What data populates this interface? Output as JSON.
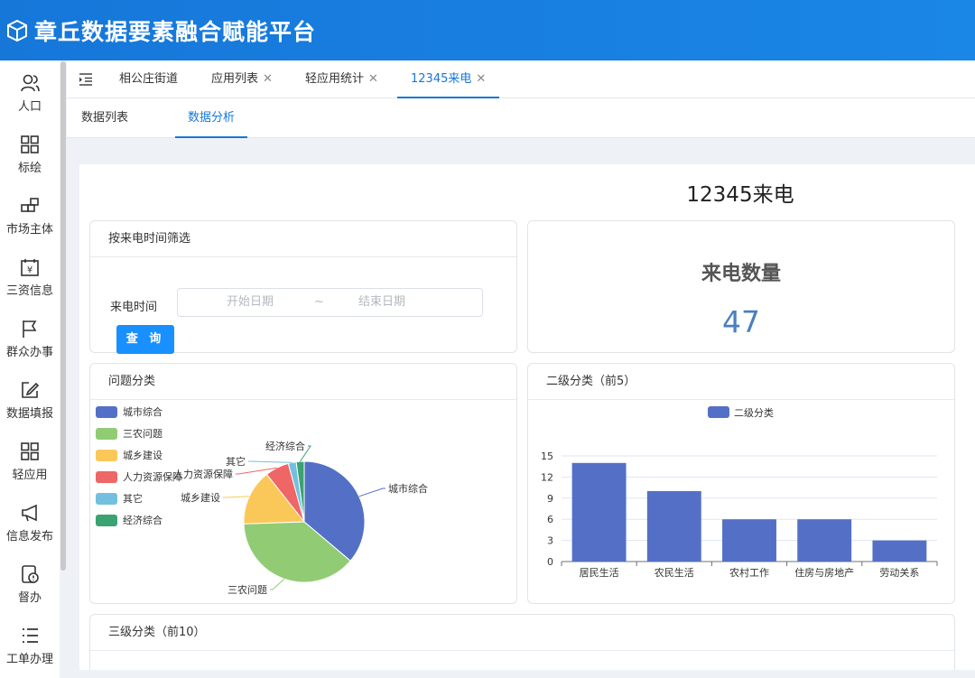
{
  "app": {
    "title": "章丘数据要素融合赋能平台"
  },
  "sidebar": {
    "items": [
      {
        "label": "人口",
        "icon": "people-icon"
      },
      {
        "label": "标绘",
        "icon": "grid-icon"
      },
      {
        "label": "市场主体",
        "icon": "blocks-icon"
      },
      {
        "label": "三资信息",
        "icon": "calendar-yen-icon"
      },
      {
        "label": "群众办事",
        "icon": "flag-icon"
      },
      {
        "label": "数据填报",
        "icon": "edit-icon"
      },
      {
        "label": "轻应用",
        "icon": "apps-icon"
      },
      {
        "label": "信息发布",
        "icon": "megaphone-icon"
      },
      {
        "label": "督办",
        "icon": "supervise-icon"
      },
      {
        "label": "工单办理",
        "icon": "list-icon"
      }
    ]
  },
  "tabs": [
    {
      "label": "相公庄街道",
      "closable": false
    },
    {
      "label": "应用列表",
      "closable": true
    },
    {
      "label": "轻应用统计",
      "closable": true
    },
    {
      "label": "12345来电",
      "closable": true,
      "active": true
    }
  ],
  "subtabs": [
    {
      "label": "数据列表"
    },
    {
      "label": "数据分析",
      "active": true
    }
  ],
  "page": {
    "heading": "12345来电"
  },
  "filter": {
    "title": "按来电时间筛选",
    "field_label": "来电时间",
    "start_placeholder": "开始日期",
    "separator": "~",
    "end_placeholder": "结束日期",
    "query_button": "查 询"
  },
  "summary": {
    "title": "来电数量",
    "value": "47"
  },
  "problem_panel": {
    "title": "问题分类"
  },
  "secondary_panel": {
    "title": "二级分类（前5）"
  },
  "tertiary_panel": {
    "title": "三级分类（前10）"
  },
  "chart_data": [
    {
      "type": "pie",
      "title": "问题分类",
      "legend_position": "top-left",
      "slices": [
        {
          "name": "城市综合",
          "value": 17,
          "color": "#5470c6"
        },
        {
          "name": "三农问题",
          "value": 18,
          "color": "#91cc75"
        },
        {
          "name": "城乡建设",
          "value": 7,
          "color": "#fac858"
        },
        {
          "name": "人力资源保障",
          "value": 3,
          "color": "#ee6666"
        },
        {
          "name": "其它",
          "value": 1,
          "color": "#73c0de"
        },
        {
          "name": "经济综合",
          "value": 1,
          "color": "#3ba272"
        }
      ]
    },
    {
      "type": "bar",
      "title": "二级分类（前5）",
      "series": [
        {
          "name": "二级分类",
          "color": "#5470c6",
          "values": [
            14,
            10,
            6,
            6,
            3
          ]
        }
      ],
      "categories": [
        "居民生活",
        "农民生活",
        "农村工作",
        "住房与房地产",
        "劳动关系"
      ],
      "ylim": [
        0,
        15
      ],
      "yticks": [
        0,
        3,
        6,
        9,
        12,
        15
      ],
      "legend_position": "top-center",
      "grid": true
    }
  ]
}
